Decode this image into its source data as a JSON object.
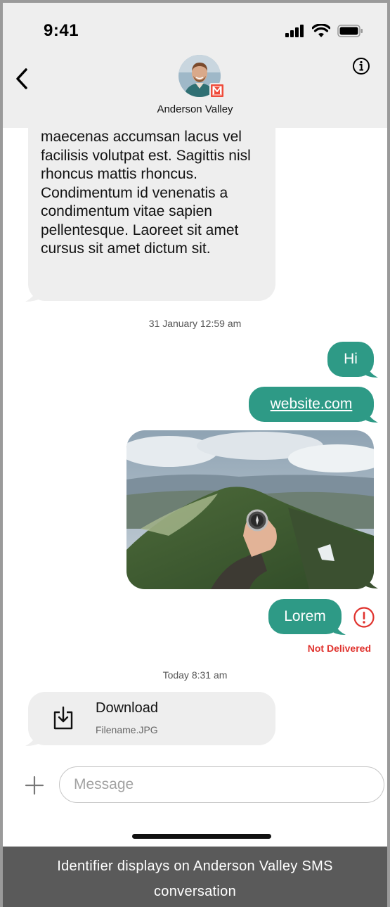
{
  "status_bar": {
    "time": "9:41",
    "icons": [
      "signal-icon",
      "wifi-icon",
      "battery-icon"
    ]
  },
  "header": {
    "contact_name": "Anderson Valley",
    "back_icon": "chevron-left-icon",
    "info_icon": "info-icon",
    "badge_letter": "M",
    "badge_color": "#ef4b3a"
  },
  "messages": {
    "incoming_long_text": "maecenas accumsan lacus vel facilisis volutpat est. Sagittis nisl rhoncus mattis rhoncus. Condimentum id venenatis a condimentum vitae sapien pellentesque. Laoreet sit amet cursus sit amet dictum sit.",
    "timestamp_1": "31 January 12:59 am",
    "outgoing_hi": "Hi",
    "outgoing_link": "website.com",
    "outgoing_lorem": "Lorem",
    "status_not_delivered": "Not Delivered",
    "timestamp_2": "Today 8:31 am",
    "attachment_title": "Download",
    "attachment_filename": "Filename.JPG"
  },
  "composer": {
    "placeholder": "Message",
    "add_icon": "plus-icon"
  },
  "caption": "Identifier displays on Anderson Valley SMS conversation",
  "colors": {
    "outgoing_bubble": "#2e9a86",
    "incoming_bubble": "#eeeeee",
    "error": "#e0332e",
    "header_bg": "#eeeeee"
  }
}
